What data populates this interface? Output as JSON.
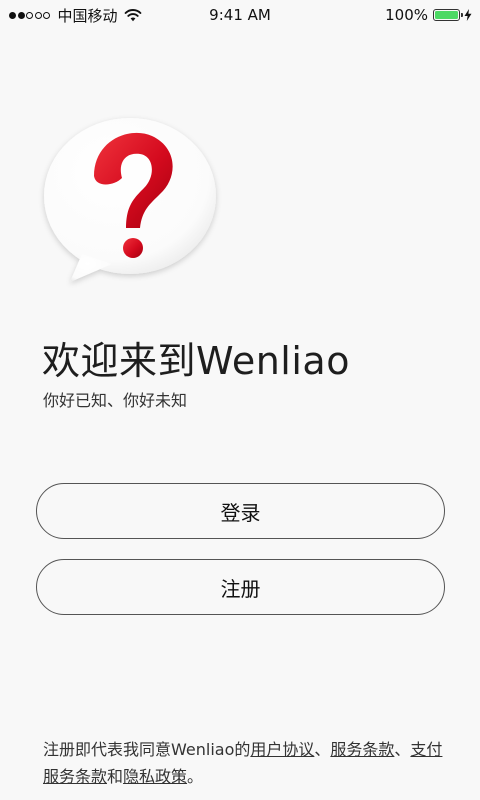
{
  "status_bar": {
    "carrier": "中国移动",
    "time": "9:41 AM",
    "battery_percent": "100%",
    "signal_strength": 2,
    "signal_total": 5,
    "battery_level": 1.0
  },
  "welcome": {
    "title": "欢迎来到Wenliao",
    "subtitle": "你好已知、你好未知"
  },
  "buttons": {
    "login_label": "登录",
    "register_label": "注册"
  },
  "agreement": {
    "prefix": "注册即代表我同意Wenliao的",
    "user_agreement": "用户协议",
    "sep1": "、",
    "service_terms": "服务条款",
    "sep2": "、",
    "payment_terms": "支付服务条款",
    "and": "和",
    "privacy_policy": "隐私政策",
    "suffix": "。"
  },
  "icons": {
    "logo": "question-mark-speech-bubble",
    "wifi": "wifi-icon",
    "battery": "battery-icon",
    "charging": "charging-bolt-icon"
  },
  "colors": {
    "background": "#f8f8f8",
    "logo_red": "#d40a1e",
    "battery_green": "#4cd964",
    "button_border": "#555555"
  }
}
